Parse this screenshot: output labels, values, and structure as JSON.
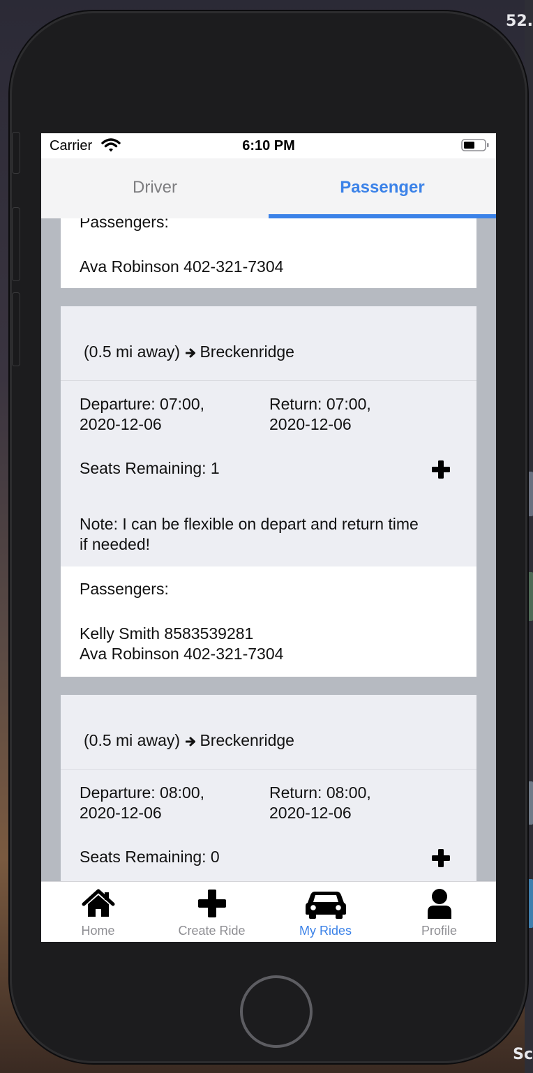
{
  "desktop": {
    "top_right_text": "52.",
    "bottom_right_text": "Sc"
  },
  "status_bar": {
    "carrier": "Carrier",
    "time": "6:10 PM"
  },
  "segmented": {
    "tabs": [
      {
        "label": "Driver"
      },
      {
        "label": "Passenger"
      }
    ],
    "selected": "Passenger"
  },
  "rides": [
    {
      "partial": true,
      "passengers_label": "Passengers:",
      "passengers": [
        "Ava Robinson 402-321-7304"
      ]
    },
    {
      "distance": "(0.5 mi away)",
      "destination": "Breckenridge",
      "departure_line1": "Departure: 07:00,",
      "departure_line2": "2020-12-06",
      "return_line1": "Return: 07:00,",
      "return_line2": "2020-12-06",
      "seats": "Seats Remaining: 1",
      "note_line1": "Note: I can be flexible on depart and return time",
      "note_line2": "if needed!",
      "passengers_label": "Passengers:",
      "passengers": [
        "Kelly Smith 8583539281",
        "Ava Robinson 402-321-7304"
      ]
    },
    {
      "distance": "(0.5 mi away)",
      "destination": "Breckenridge",
      "departure_line1": "Departure: 08:00,",
      "departure_line2": "2020-12-06",
      "return_line1": "Return: 08:00,",
      "return_line2": "2020-12-06",
      "seats": "Seats Remaining: 0"
    }
  ],
  "tab_bar": {
    "items": [
      {
        "label": "Home",
        "icon": "home-icon"
      },
      {
        "label": "Create Ride",
        "icon": "plus-icon"
      },
      {
        "label": "My Rides",
        "icon": "car-icon"
      },
      {
        "label": "Profile",
        "icon": "user-icon"
      }
    ],
    "active": "My Rides"
  },
  "colors": {
    "accent": "#3b82e8",
    "inactive": "#8e8e93",
    "card_bg": "#edeef3",
    "list_bg": "#b6bac1"
  }
}
